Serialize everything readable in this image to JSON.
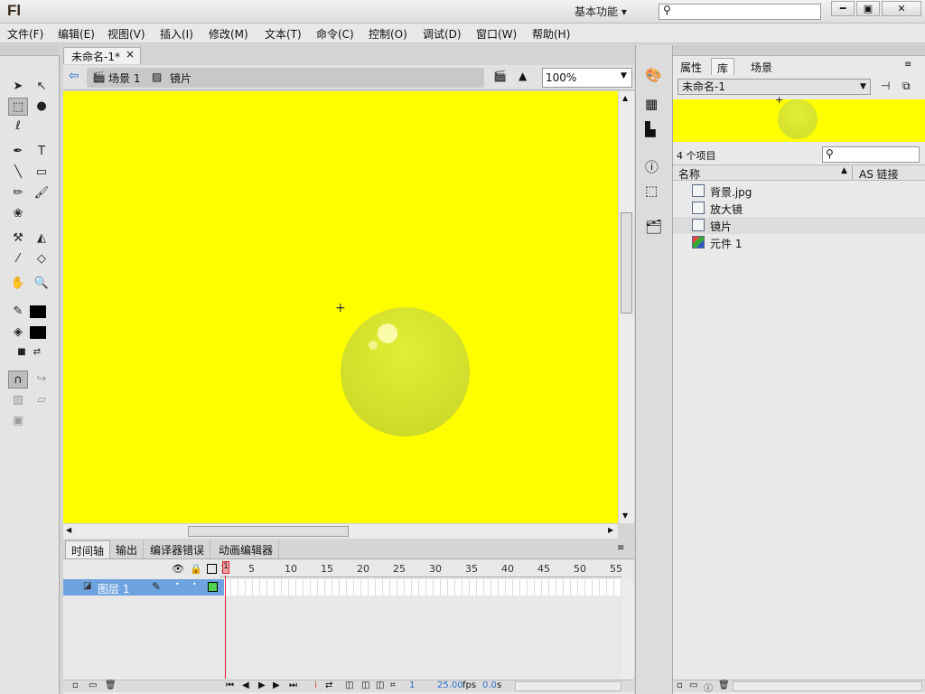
{
  "app": {
    "logo": "Fl",
    "workspace": "基本功能",
    "search_placeholder": ""
  },
  "window_buttons": {
    "minimize": "━",
    "restore": "▣",
    "close": "✕"
  },
  "menu": [
    "文件(F)",
    "编辑(E)",
    "视图(V)",
    "插入(I)",
    "修改(M)",
    "文本(T)",
    "命令(C)",
    "控制(O)",
    "调试(D)",
    "窗口(W)",
    "帮助(H)"
  ],
  "document": {
    "tab_title": "未命名-1*",
    "tab_close": "×"
  },
  "breadcrumb": {
    "scene": "场景 1",
    "symbol": "镜片"
  },
  "zoom": {
    "value": "100%"
  },
  "colors": {
    "stage_bg": "#ffff00",
    "bubble": "#d2de2b",
    "layer_highlight": "#6fa3e0",
    "playhead": "#e0232b"
  },
  "timeline": {
    "tabs": [
      "时间轴",
      "输出",
      "编译器错误",
      "动画编辑器"
    ],
    "ruler": [
      "1",
      "5",
      "10",
      "15",
      "20",
      "25",
      "30",
      "35",
      "40",
      "45",
      "50",
      "55"
    ],
    "layer_name": "图层 1",
    "current_frame": "1",
    "fps": "25.00",
    "fps_unit": "fps",
    "time": "0.0",
    "time_unit": "s"
  },
  "right_panel": {
    "tabs": [
      "属性",
      "库",
      "场景"
    ],
    "library_name": "未命名-1",
    "item_count": "4 个项目",
    "col_name": "名称",
    "col_link": "AS 链接",
    "items": [
      {
        "name": "背景.jpg",
        "icon": "bitmap-icon"
      },
      {
        "name": "放大镜",
        "icon": "graphic-symbol-icon"
      },
      {
        "name": "镜片",
        "icon": "graphic-symbol-icon"
      },
      {
        "name": "元件 1",
        "icon": "movieclip-symbol-icon"
      }
    ]
  }
}
